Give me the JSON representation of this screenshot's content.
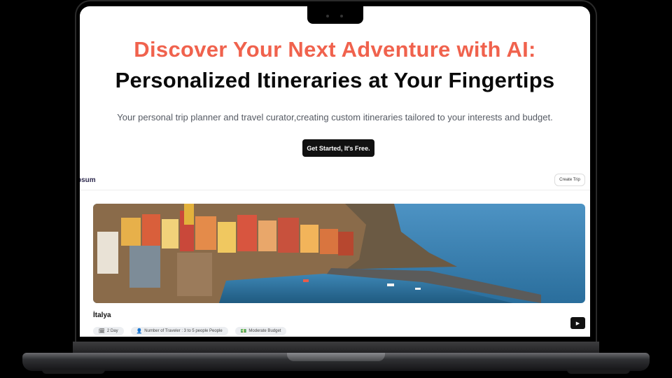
{
  "hero": {
    "title_line1": "Discover Your Next Adventure with AI:",
    "title_line2": "Personalized Itineraries at Your Fingertips",
    "subtitle": "Your personal trip planner and travel curator,creating custom itineraries tailored to your interests and budget.",
    "cta_label": "Get Started, It's Free.",
    "title_accent_color": "#f0624d"
  },
  "app_preview": {
    "logo_text": "psum",
    "create_trip_label": "Create Trip",
    "trip": {
      "name": "İtalya",
      "image": "coastal-village-icon",
      "badges": [
        {
          "icon": "calendar-icon",
          "glyph": "🗓",
          "label": "2 Day"
        },
        {
          "icon": "traveler-icon",
          "glyph": "👤",
          "label": "Number of Traveler : 3 to 5 people People"
        },
        {
          "icon": "money-icon",
          "glyph": "💵",
          "label": "Moderate Budget"
        }
      ],
      "action_icon": "play-icon",
      "action_glyph": "▶"
    }
  }
}
